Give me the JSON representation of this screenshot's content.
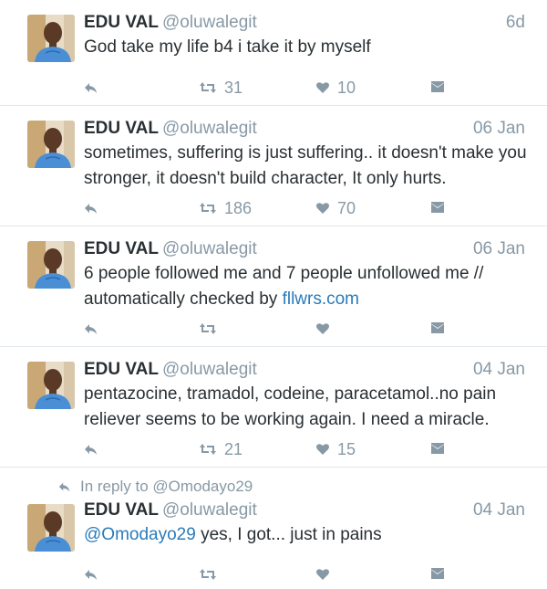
{
  "tweets": [
    {
      "name": "EDU VAL",
      "handle": "@oluwalegit",
      "time": "6d",
      "text": "God take my life b4 i take it by myself",
      "retweets": "31",
      "likes": "10"
    },
    {
      "name": "EDU VAL",
      "handle": "@oluwalegit",
      "time": "06 Jan",
      "text": "sometimes, suffering is just suffering.. it doesn't make you stronger, it doesn't build character, It only hurts.",
      "retweets": "186",
      "likes": "70"
    },
    {
      "name": "EDU VAL",
      "handle": "@oluwalegit",
      "time": "06 Jan",
      "text": "6 people followed me and 7 people unfollowed me // automatically checked by ",
      "link": "fllwrs.com",
      "retweets": "",
      "likes": ""
    },
    {
      "name": "EDU VAL",
      "handle": "@oluwalegit",
      "time": "04 Jan",
      "text": "pentazocine, tramadol, codeine, paracetamol..no pain reliever seems to be working again. I need a miracle.",
      "retweets": "21",
      "likes": "15"
    },
    {
      "reply_context": "In reply to @Omodayo29",
      "name": "EDU VAL",
      "handle": "@oluwalegit",
      "time": "04 Jan",
      "mention": "@Omodayo29",
      "text": " yes, I got... just in pains",
      "retweets": "",
      "likes": ""
    }
  ],
  "icons": {
    "reply": "reply-icon",
    "retweet": "retweet-icon",
    "like": "heart-icon",
    "message": "message-icon"
  },
  "colors": {
    "name": "#292f33",
    "meta": "#8899a6",
    "link": "#2b7bb9",
    "divider": "#e1e8ed"
  }
}
